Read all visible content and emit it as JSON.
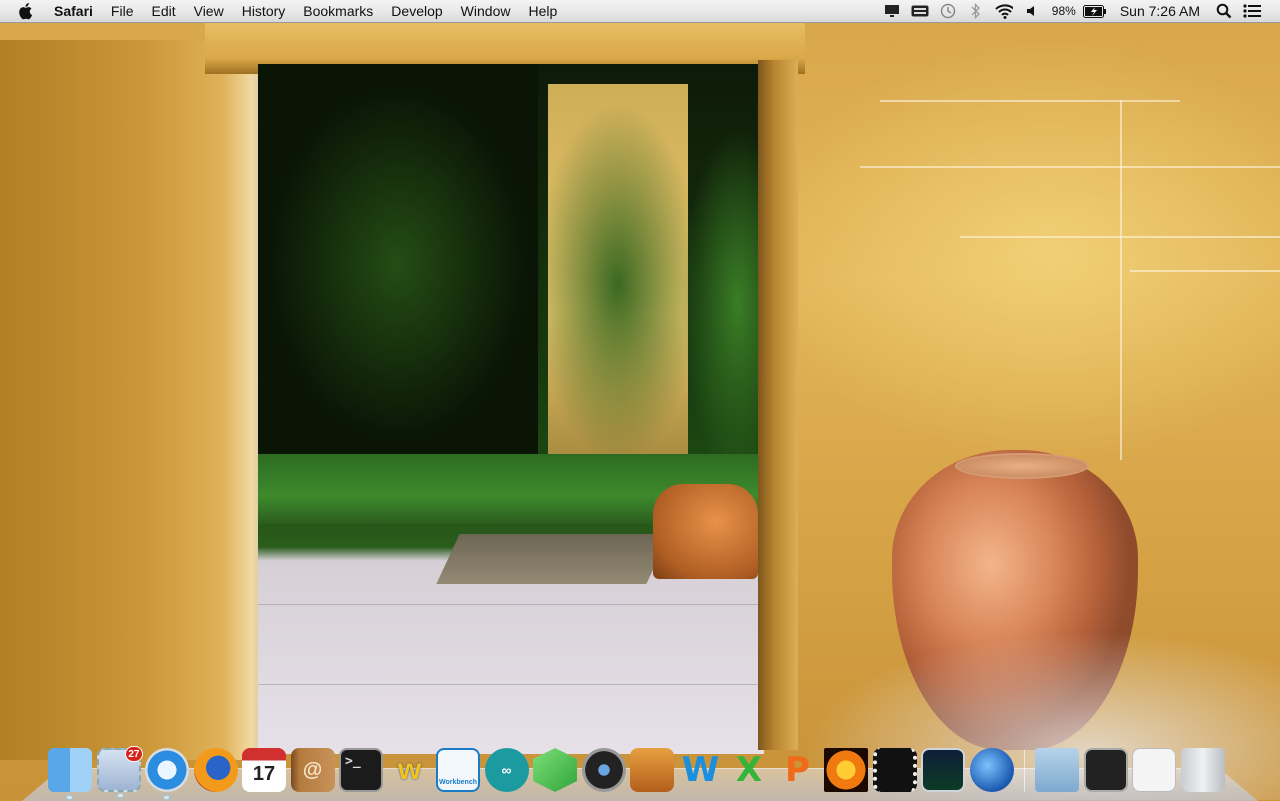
{
  "menubar": {
    "app_name": "Safari",
    "menus": [
      "File",
      "Edit",
      "View",
      "History",
      "Bookmarks",
      "Develop",
      "Window",
      "Help"
    ],
    "status": {
      "battery_percent": "98%",
      "clock": "Sun 7:26 AM"
    }
  },
  "dock": {
    "mail_badge": "27",
    "calendar_day": "17",
    "terminal_prompt": ">_",
    "arduino_symbol": "∞",
    "word_letter": "W",
    "excel_letter": "X",
    "powerpoint_letter": "P",
    "mysql_label": "Workbench"
  },
  "colors": {
    "menubar_top": "#f4f4f4",
    "wall_ochre": "#d8a64a",
    "urn_terracotta": "#d9875a",
    "badge_red": "#d5251c"
  }
}
